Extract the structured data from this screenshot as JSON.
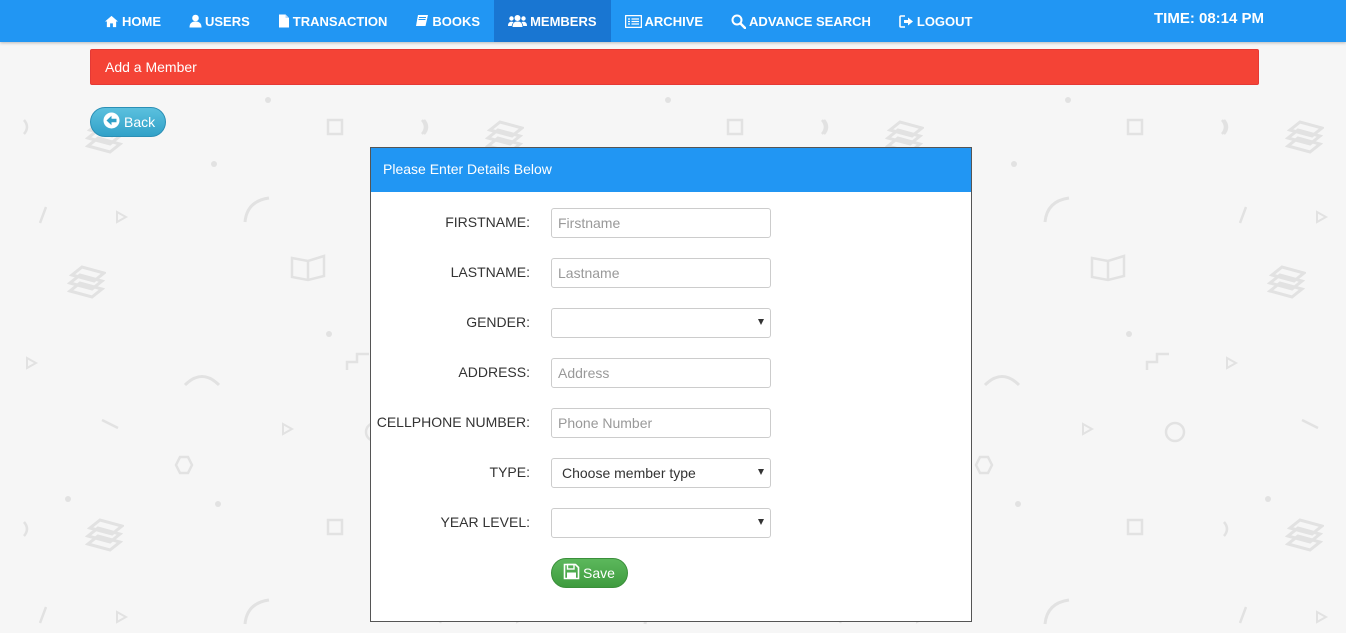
{
  "nav": {
    "items": [
      {
        "label": "HOME",
        "icon": "home-icon"
      },
      {
        "label": "USERS",
        "icon": "user-icon"
      },
      {
        "label": "TRANSACTION",
        "icon": "document-icon"
      },
      {
        "label": "BOOKS",
        "icon": "book-icon"
      },
      {
        "label": "MEMBERS",
        "icon": "group-icon",
        "active": true
      },
      {
        "label": "ARCHIVE",
        "icon": "list-icon"
      },
      {
        "label": "ADVANCE SEARCH",
        "icon": "search-icon"
      },
      {
        "label": "LOGOUT",
        "icon": "logout-icon"
      }
    ],
    "clock": "TIME: 08:14 PM"
  },
  "page": {
    "header": "Add a Member",
    "back_label": "Back"
  },
  "form": {
    "heading": "Please Enter Details Below",
    "firstname": {
      "label": "FIRSTNAME:",
      "placeholder": "Firstname"
    },
    "lastname": {
      "label": "LASTNAME:",
      "placeholder": "Lastname"
    },
    "gender": {
      "label": "GENDER:",
      "value": ""
    },
    "address": {
      "label": "ADDRESS:",
      "placeholder": "Address"
    },
    "phone": {
      "label": "CELLPHONE NUMBER:",
      "placeholder": "Phone Number"
    },
    "type": {
      "label": "TYPE:",
      "value": "Choose member type"
    },
    "year_level": {
      "label": "YEAR LEVEL:",
      "value": ""
    },
    "save_label": "Save"
  },
  "colors": {
    "navbar": "#2196f3",
    "nav_active": "#1976d2",
    "header_alert": "#f44336",
    "back_button": "#31a1c8",
    "save_button": "#4cae4c"
  }
}
